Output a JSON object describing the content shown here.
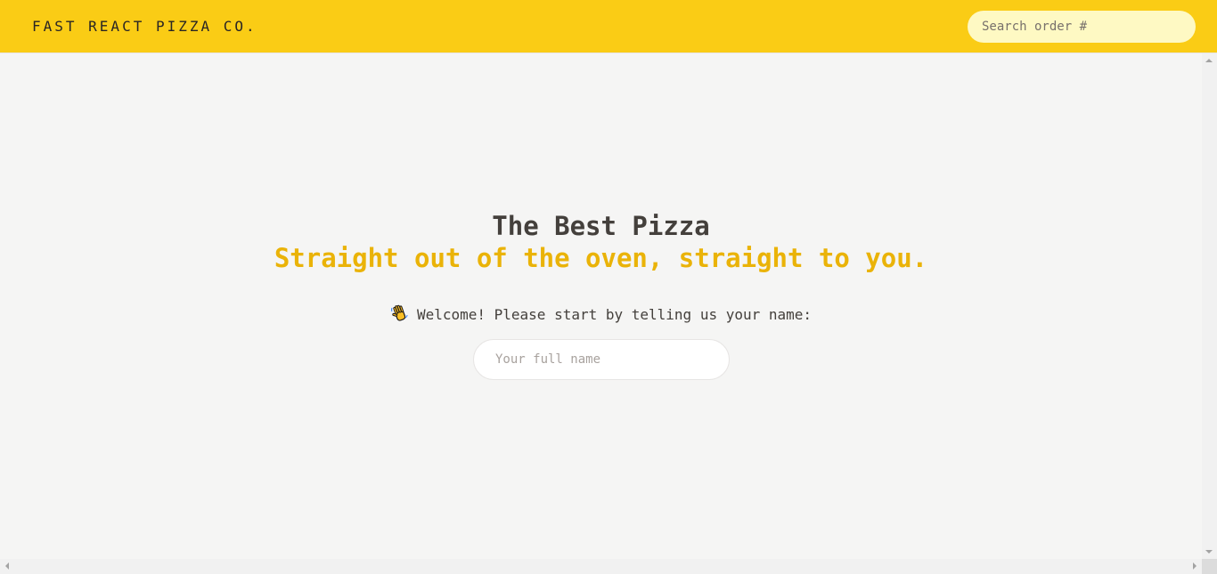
{
  "header": {
    "logo_text": "FAST REACT PIZZA CO.",
    "search_placeholder": "Search order #",
    "background_color": "#facc15"
  },
  "hero": {
    "title": "The Best Pizza",
    "subtitle": "Straight out of the oven, straight to you.",
    "accent_color": "#eab308"
  },
  "welcome": {
    "icon": "waving-hand-icon",
    "text": "Welcome! Please start by telling us your name:"
  },
  "name_form": {
    "placeholder": "Your full name"
  }
}
